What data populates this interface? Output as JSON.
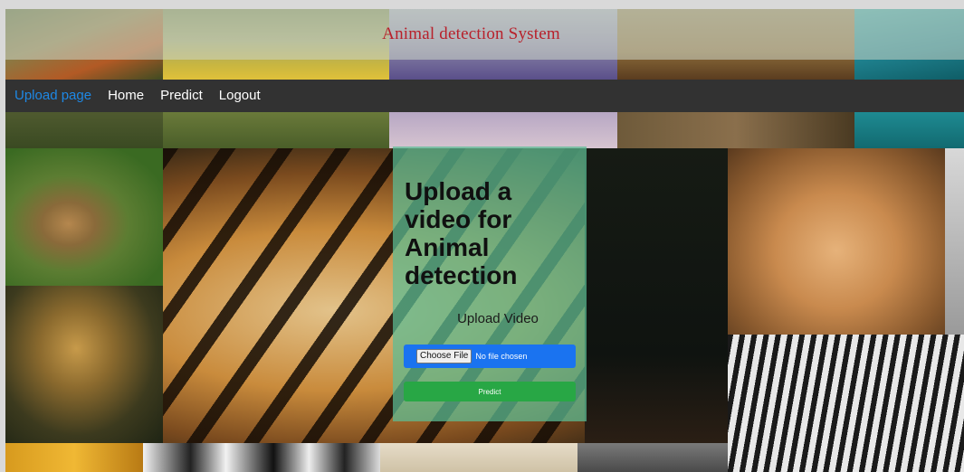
{
  "header": {
    "title": "Animal detection System"
  },
  "nav": {
    "items": [
      {
        "label": "Upload page",
        "active": true
      },
      {
        "label": "Home",
        "active": false
      },
      {
        "label": "Predict",
        "active": false
      },
      {
        "label": "Logout",
        "active": false
      }
    ]
  },
  "upload_card": {
    "heading": "Upload a video for Animal detection",
    "upload_label": "Upload Video",
    "file_button_label": "Choose File",
    "file_status": "No file chosen",
    "predict_label": "Predict"
  },
  "colors": {
    "title": "#b8202b",
    "nav_active": "#1e88e5",
    "navbar_bg": "#323232",
    "card_bg": "#5cbe96",
    "file_row": "#1a73f0",
    "predict_button": "#28a745"
  }
}
